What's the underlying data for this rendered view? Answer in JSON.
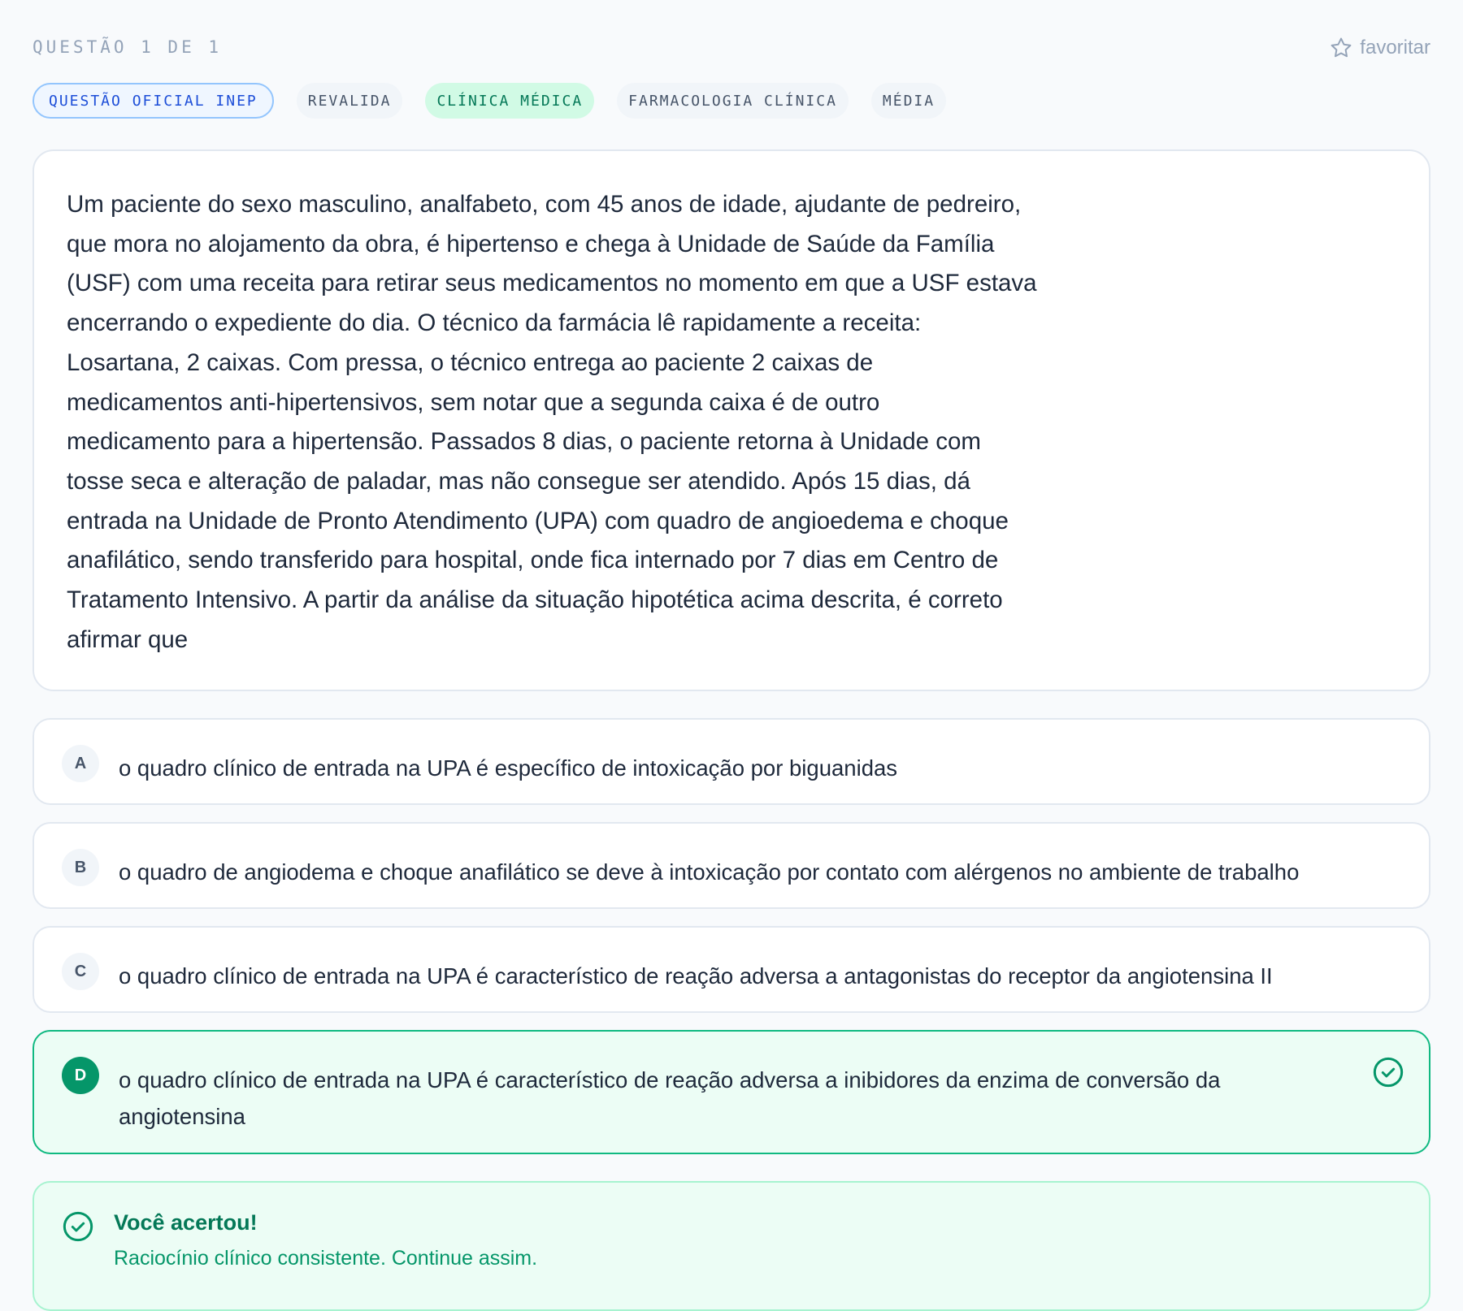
{
  "header": {
    "question_label": "QUESTÃO 1 DE 1",
    "favorite_label": "favoritar"
  },
  "tags": [
    "QUESTÃO OFICIAL INEP",
    "REVALIDA",
    "CLÍNICA MÉDICA",
    "FARMACOLOGIA CLÍNICA",
    "MÉDIA"
  ],
  "question": {
    "lines": [
      "Um paciente do sexo masculino, analfabeto, com 45 anos de idade, ajudante de pedreiro,",
      "que mora no alojamento da obra, é hipertenso e chega à Unidade de Saúde da Família",
      "(USF) com uma receita para retirar seus medicamentos no momento em que a USF estava",
      "encerrando o expediente do dia. O técnico da farmácia lê rapidamente a receita:",
      "Losartana, 2 caixas. Com pressa, o técnico entrega ao paciente 2 caixas de",
      "medicamentos anti-hipertensivos, sem notar que a segunda caixa é de outro",
      "medicamento para a hipertensão. Passados 8 dias, o paciente retorna à Unidade com",
      "tosse seca e alteração de paladar, mas não consegue ser atendido. Após 15 dias, dá",
      "entrada na Unidade de Pronto Atendimento (UPA) com quadro de angioedema e choque",
      "anafilático, sendo transferido para hospital, onde fica internado por 7 dias em Centro de",
      "Tratamento Intensivo. A partir da análise da situação hipotética acima descrita, é correto",
      "afirmar que"
    ]
  },
  "options": [
    {
      "letter": "A",
      "text": "o quadro clínico de entrada na UPA é específico de intoxicação por biguanidas"
    },
    {
      "letter": "B",
      "text": "o quadro de angiodema e choque anafilático se deve à intoxicação por contato com alérgenos no ambiente de trabalho"
    },
    {
      "letter": "C",
      "text": "o quadro clínico de entrada na UPA é característico de reação adversa a antagonistas do receptor da angiotensina II"
    },
    {
      "letter": "D",
      "text": "o quadro clínico de entrada na UPA é característico de reação adversa a inibidores da enzima de conversão da angiotensina"
    }
  ],
  "feedback": {
    "title": "Você acertou!",
    "message": "Raciocínio clínico consistente. Continue assim."
  },
  "colors": {
    "correct_accent": "#10b981",
    "correct_bg": "#ecfdf5",
    "inep_blue": "#1d4ed8"
  },
  "icons": {
    "favorite": "star-outline-icon",
    "correct": "check-circle-icon"
  }
}
